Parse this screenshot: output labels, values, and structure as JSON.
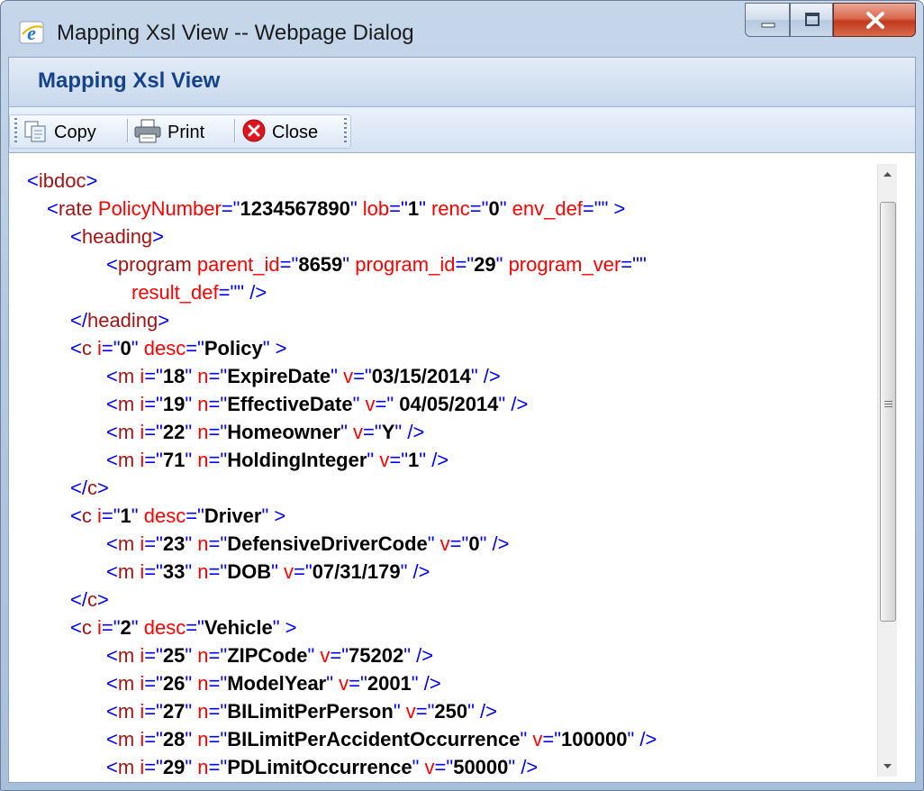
{
  "window": {
    "title": "Mapping Xsl View -- Webpage Dialog",
    "icon": "ie-icon",
    "controls": [
      "minimize",
      "maximize",
      "close"
    ]
  },
  "panel": {
    "title": "Mapping Xsl View"
  },
  "toolbar": {
    "copy_label": "Copy",
    "print_label": "Print",
    "close_label": "Close"
  },
  "xml_lines": [
    {
      "indent": 0,
      "parts": [
        [
          "p",
          "<"
        ],
        [
          "tn",
          "ibdoc"
        ],
        [
          "p",
          ">"
        ]
      ]
    },
    {
      "indent": 1,
      "parts": [
        [
          "p",
          "<"
        ],
        [
          "tn",
          "rate "
        ],
        [
          "an",
          "PolicyNumber"
        ],
        [
          "p",
          "=\""
        ],
        [
          "av",
          "1234567890"
        ],
        [
          "p",
          "\"  "
        ],
        [
          "an",
          "lob"
        ],
        [
          "p",
          "=\""
        ],
        [
          "av",
          "1"
        ],
        [
          "p",
          "\"  "
        ],
        [
          "an",
          "renc"
        ],
        [
          "p",
          "=\""
        ],
        [
          "av",
          "0"
        ],
        [
          "p",
          "\"  "
        ],
        [
          "an",
          "env_def"
        ],
        [
          "p",
          "=\"\" >"
        ]
      ]
    },
    {
      "indent": 2,
      "parts": [
        [
          "p",
          "<"
        ],
        [
          "tn",
          "heading"
        ],
        [
          "p",
          ">"
        ]
      ]
    },
    {
      "indent": 3,
      "parts": [
        [
          "p",
          "<"
        ],
        [
          "tn",
          "program "
        ],
        [
          "an",
          "parent_id"
        ],
        [
          "p",
          "=\""
        ],
        [
          "av",
          "8659"
        ],
        [
          "p",
          "\"  "
        ],
        [
          "an",
          "program_id"
        ],
        [
          "p",
          "=\""
        ],
        [
          "av",
          "29"
        ],
        [
          "p",
          "\"  "
        ],
        [
          "an",
          "program_ver"
        ],
        [
          "p",
          "=\"\""
        ]
      ]
    },
    {
      "indent": 4,
      "parts": [
        [
          "an",
          "result_def"
        ],
        [
          "p",
          "=\"\" />"
        ]
      ]
    },
    {
      "indent": 2,
      "parts": [
        [
          "p",
          "</"
        ],
        [
          "tn",
          "heading"
        ],
        [
          "p",
          ">"
        ]
      ]
    },
    {
      "indent": 2,
      "parts": [
        [
          "p",
          "<"
        ],
        [
          "tn",
          "c "
        ],
        [
          "an",
          "i"
        ],
        [
          "p",
          "=\""
        ],
        [
          "av",
          "0"
        ],
        [
          "p",
          "\"  "
        ],
        [
          "an",
          "desc"
        ],
        [
          "p",
          "=\""
        ],
        [
          "av",
          "Policy"
        ],
        [
          "p",
          "\" >"
        ]
      ]
    },
    {
      "indent": 3,
      "parts": [
        [
          "p",
          "<"
        ],
        [
          "tn",
          "m "
        ],
        [
          "an",
          "i"
        ],
        [
          "p",
          "=\""
        ],
        [
          "av",
          "18"
        ],
        [
          "p",
          "\"  "
        ],
        [
          "an",
          "n"
        ],
        [
          "p",
          "=\""
        ],
        [
          "av",
          "ExpireDate"
        ],
        [
          "p",
          "\"  "
        ],
        [
          "an",
          "v"
        ],
        [
          "p",
          "=\""
        ],
        [
          "av",
          "03/15/2014"
        ],
        [
          "p",
          "\" />"
        ]
      ]
    },
    {
      "indent": 3,
      "parts": [
        [
          "p",
          "<"
        ],
        [
          "tn",
          "m "
        ],
        [
          "an",
          "i"
        ],
        [
          "p",
          "=\""
        ],
        [
          "av",
          "19"
        ],
        [
          "p",
          "\"  "
        ],
        [
          "an",
          "n"
        ],
        [
          "p",
          "=\""
        ],
        [
          "av",
          "EffectiveDate"
        ],
        [
          "p",
          "\"  "
        ],
        [
          "an",
          "v"
        ],
        [
          "p",
          "=\" "
        ],
        [
          "av",
          "04/05/2014"
        ],
        [
          "p",
          "\" />"
        ]
      ]
    },
    {
      "indent": 3,
      "parts": [
        [
          "p",
          "<"
        ],
        [
          "tn",
          "m "
        ],
        [
          "an",
          "i"
        ],
        [
          "p",
          "=\""
        ],
        [
          "av",
          "22"
        ],
        [
          "p",
          "\"  "
        ],
        [
          "an",
          "n"
        ],
        [
          "p",
          "=\""
        ],
        [
          "av",
          "Homeowner"
        ],
        [
          "p",
          "\"  "
        ],
        [
          "an",
          "v"
        ],
        [
          "p",
          "=\""
        ],
        [
          "av",
          "Y"
        ],
        [
          "p",
          "\" />"
        ]
      ]
    },
    {
      "indent": 3,
      "parts": [
        [
          "p",
          "<"
        ],
        [
          "tn",
          "m "
        ],
        [
          "an",
          "i"
        ],
        [
          "p",
          "=\""
        ],
        [
          "av",
          "71"
        ],
        [
          "p",
          "\"  "
        ],
        [
          "an",
          "n"
        ],
        [
          "p",
          "=\""
        ],
        [
          "av",
          "HoldingInteger"
        ],
        [
          "p",
          "\"  "
        ],
        [
          "an",
          "v"
        ],
        [
          "p",
          "=\""
        ],
        [
          "av",
          "1"
        ],
        [
          "p",
          "\" />"
        ]
      ]
    },
    {
      "indent": 2,
      "parts": [
        [
          "p",
          "</"
        ],
        [
          "tn",
          "c"
        ],
        [
          "p",
          ">"
        ]
      ]
    },
    {
      "indent": 2,
      "parts": [
        [
          "p",
          "<"
        ],
        [
          "tn",
          "c "
        ],
        [
          "an",
          "i"
        ],
        [
          "p",
          "=\""
        ],
        [
          "av",
          "1"
        ],
        [
          "p",
          "\"  "
        ],
        [
          "an",
          "desc"
        ],
        [
          "p",
          "=\""
        ],
        [
          "av",
          "Driver"
        ],
        [
          "p",
          "\" >"
        ]
      ]
    },
    {
      "indent": 3,
      "parts": [
        [
          "p",
          "<"
        ],
        [
          "tn",
          "m "
        ],
        [
          "an",
          "i"
        ],
        [
          "p",
          "=\""
        ],
        [
          "av",
          "23"
        ],
        [
          "p",
          "\"  "
        ],
        [
          "an",
          "n"
        ],
        [
          "p",
          "=\""
        ],
        [
          "av",
          "DefensiveDriverCode"
        ],
        [
          "p",
          "\"  "
        ],
        [
          "an",
          "v"
        ],
        [
          "p",
          "=\""
        ],
        [
          "av",
          "0"
        ],
        [
          "p",
          "\" />"
        ]
      ]
    },
    {
      "indent": 3,
      "parts": [
        [
          "p",
          "<"
        ],
        [
          "tn",
          "m "
        ],
        [
          "an",
          "i"
        ],
        [
          "p",
          "=\""
        ],
        [
          "av",
          "33"
        ],
        [
          "p",
          "\"  "
        ],
        [
          "an",
          "n"
        ],
        [
          "p",
          "=\""
        ],
        [
          "av",
          "DOB"
        ],
        [
          "p",
          "\"  "
        ],
        [
          "an",
          "v"
        ],
        [
          "p",
          "=\""
        ],
        [
          "av",
          "07/31/179"
        ],
        [
          "p",
          "\" />"
        ]
      ]
    },
    {
      "indent": 2,
      "parts": [
        [
          "p",
          "</"
        ],
        [
          "tn",
          "c"
        ],
        [
          "p",
          ">"
        ]
      ]
    },
    {
      "indent": 2,
      "parts": [
        [
          "p",
          "<"
        ],
        [
          "tn",
          "c "
        ],
        [
          "an",
          "i"
        ],
        [
          "p",
          "=\""
        ],
        [
          "av",
          "2"
        ],
        [
          "p",
          "\"  "
        ],
        [
          "an",
          "desc"
        ],
        [
          "p",
          "=\""
        ],
        [
          "av",
          "Vehicle"
        ],
        [
          "p",
          "\" >"
        ]
      ]
    },
    {
      "indent": 3,
      "parts": [
        [
          "p",
          "<"
        ],
        [
          "tn",
          "m "
        ],
        [
          "an",
          "i"
        ],
        [
          "p",
          "=\""
        ],
        [
          "av",
          "25"
        ],
        [
          "p",
          "\"  "
        ],
        [
          "an",
          "n"
        ],
        [
          "p",
          "=\""
        ],
        [
          "av",
          "ZIPCode"
        ],
        [
          "p",
          "\"  "
        ],
        [
          "an",
          "v"
        ],
        [
          "p",
          "=\""
        ],
        [
          "av",
          "75202"
        ],
        [
          "p",
          "\" />"
        ]
      ]
    },
    {
      "indent": 3,
      "parts": [
        [
          "p",
          "<"
        ],
        [
          "tn",
          "m "
        ],
        [
          "an",
          "i"
        ],
        [
          "p",
          "=\""
        ],
        [
          "av",
          "26"
        ],
        [
          "p",
          "\"  "
        ],
        [
          "an",
          "n"
        ],
        [
          "p",
          "=\""
        ],
        [
          "av",
          "ModelYear"
        ],
        [
          "p",
          "\"  "
        ],
        [
          "an",
          "v"
        ],
        [
          "p",
          "=\""
        ],
        [
          "av",
          "2001"
        ],
        [
          "p",
          "\" />"
        ]
      ]
    },
    {
      "indent": 3,
      "parts": [
        [
          "p",
          "<"
        ],
        [
          "tn",
          "m "
        ],
        [
          "an",
          "i"
        ],
        [
          "p",
          "=\""
        ],
        [
          "av",
          "27"
        ],
        [
          "p",
          "\"  "
        ],
        [
          "an",
          "n"
        ],
        [
          "p",
          "=\""
        ],
        [
          "av",
          "BILimitPerPerson"
        ],
        [
          "p",
          "\"  "
        ],
        [
          "an",
          "v"
        ],
        [
          "p",
          "=\""
        ],
        [
          "av",
          "250"
        ],
        [
          "p",
          "\" />"
        ]
      ]
    },
    {
      "indent": 3,
      "parts": [
        [
          "p",
          "<"
        ],
        [
          "tn",
          "m "
        ],
        [
          "an",
          "i"
        ],
        [
          "p",
          "=\""
        ],
        [
          "av",
          "28"
        ],
        [
          "p",
          "\"  "
        ],
        [
          "an",
          "n"
        ],
        [
          "p",
          "=\""
        ],
        [
          "av",
          "BILimitPerAccidentOccurrence"
        ],
        [
          "p",
          "\"  "
        ],
        [
          "an",
          "v"
        ],
        [
          "p",
          "=\""
        ],
        [
          "av",
          "100000"
        ],
        [
          "p",
          "\" />"
        ]
      ]
    },
    {
      "indent": 3,
      "parts": [
        [
          "p",
          "<"
        ],
        [
          "tn",
          "m "
        ],
        [
          "an",
          "i"
        ],
        [
          "p",
          "=\""
        ],
        [
          "av",
          "29"
        ],
        [
          "p",
          "\"  "
        ],
        [
          "an",
          "n"
        ],
        [
          "p",
          "=\""
        ],
        [
          "av",
          "PDLimitOccurrence"
        ],
        [
          "p",
          "\"  "
        ],
        [
          "an",
          "v"
        ],
        [
          "p",
          "=\""
        ],
        [
          "av",
          "50000"
        ],
        [
          "p",
          "\" />"
        ]
      ]
    }
  ],
  "colors": {
    "tag": "#a31515",
    "attribute": "#ff0000",
    "punctuation": "#0000ff",
    "value": "#000000",
    "panel_title": "#15428b"
  }
}
